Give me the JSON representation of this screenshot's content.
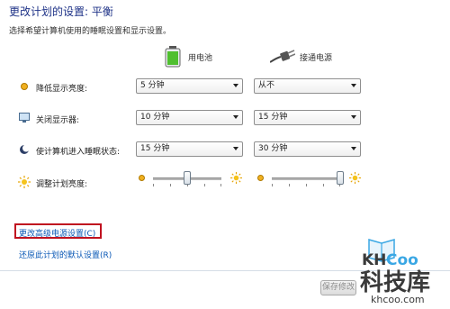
{
  "page": {
    "title": "更改计划的设置: 平衡",
    "subtitle": "选择希望计算机使用的睡眠设置和显示设置。"
  },
  "columns": {
    "battery": "用电池",
    "plugged": "接通电源"
  },
  "rows": [
    {
      "label": "降低显示亮度:",
      "icon": "dim-brightness-icon",
      "battery": "5 分钟",
      "plugged": "从不"
    },
    {
      "label": "关闭显示器:",
      "icon": "monitor-icon",
      "battery": "10 分钟",
      "plugged": "15 分钟"
    },
    {
      "label": "使计算机进入睡眠状态:",
      "icon": "sleep-moon-icon",
      "battery": "15 分钟",
      "plugged": "30 分钟"
    }
  ],
  "brightness": {
    "label": "调整计划亮度:",
    "icon": "sun-icon",
    "battery_level": 0.5,
    "plugged_level": 1.0
  },
  "links": {
    "advanced": "更改高级电源设置(C)",
    "restore": "还原此计划的默认设置(R)"
  },
  "buttons": {
    "save": "保存修改"
  },
  "watermark": {
    "brand": "KHCoo",
    "name": "科技库",
    "url": "khcoo.com"
  },
  "colors": {
    "title": "#1e3287",
    "link": "#0a58b6",
    "highlight_box": "#c0111f",
    "watermark_dark": "#3a3a3a",
    "watermark_accent": "#3aa7e4"
  }
}
